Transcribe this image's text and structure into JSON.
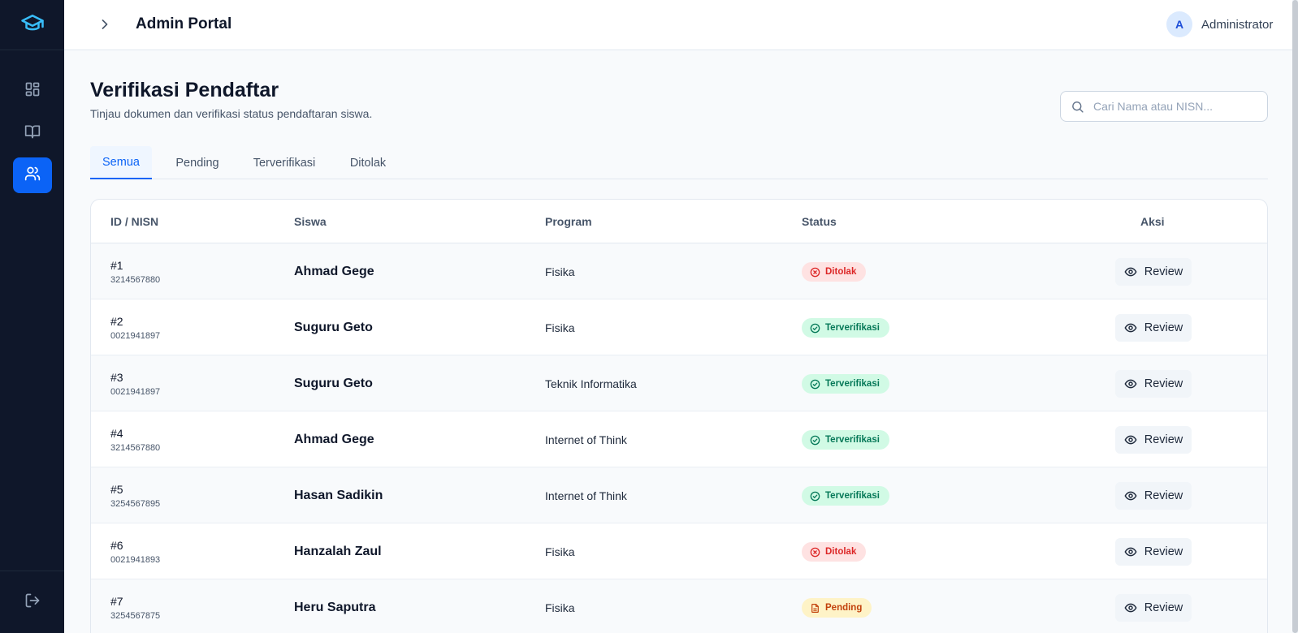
{
  "header": {
    "title": "Admin Portal",
    "avatar_initial": "A",
    "user_name": "Administrator"
  },
  "page": {
    "title": "Verifikasi Pendaftar",
    "subtitle": "Tinjau dokumen dan verifikasi status pendaftaran siswa.",
    "search_placeholder": "Cari Nama atau NISN...",
    "search_value": ""
  },
  "tabs": [
    {
      "label": "Semua",
      "active": true
    },
    {
      "label": "Pending",
      "active": false
    },
    {
      "label": "Terverifikasi",
      "active": false
    },
    {
      "label": "Ditolak",
      "active": false
    }
  ],
  "table": {
    "columns": [
      "ID / NISN",
      "Siswa",
      "Program",
      "Status",
      "Aksi"
    ],
    "rows": [
      {
        "id": "#1",
        "nisn": "3214567880",
        "name": "Ahmad Gege",
        "program": "Fisika",
        "status": "Ditolak",
        "action": "Review"
      },
      {
        "id": "#2",
        "nisn": "0021941897",
        "name": "Suguru Geto",
        "program": "Fisika",
        "status": "Terverifikasi",
        "action": "Review"
      },
      {
        "id": "#3",
        "nisn": "0021941897",
        "name": "Suguru Geto",
        "program": "Teknik Informatika",
        "status": "Terverifikasi",
        "action": "Review"
      },
      {
        "id": "#4",
        "nisn": "3214567880",
        "name": "Ahmad Gege",
        "program": "Internet of Think",
        "status": "Terverifikasi",
        "action": "Review"
      },
      {
        "id": "#5",
        "nisn": "3254567895",
        "name": "Hasan Sadikin",
        "program": "Internet of Think",
        "status": "Terverifikasi",
        "action": "Review"
      },
      {
        "id": "#6",
        "nisn": "0021941893",
        "name": "Hanzalah Zaul",
        "program": "Fisika",
        "status": "Ditolak",
        "action": "Review"
      },
      {
        "id": "#7",
        "nisn": "3254567875",
        "name": "Heru Saputra",
        "program": "Fisika",
        "status": "Pending",
        "action": "Review"
      }
    ]
  },
  "status_colors": {
    "Ditolak": {
      "bg": "#fee2e2",
      "fg": "#dc2626",
      "icon": "x-circle-icon"
    },
    "Terverifikasi": {
      "bg": "#d1fae5",
      "fg": "#047857",
      "icon": "check-circle-icon"
    },
    "Pending": {
      "bg": "#fef3c7",
      "fg": "#c2410c",
      "icon": "document-icon"
    }
  },
  "sidebar": {
    "items": [
      {
        "icon": "dashboard-icon",
        "active": false
      },
      {
        "icon": "book-icon",
        "active": false
      },
      {
        "icon": "users-icon",
        "active": true
      }
    ],
    "logo_icon": "graduation-cap-icon",
    "logout_icon": "logout-icon"
  },
  "colors": {
    "accent": "#0b63f6",
    "sidebar_bg": "#0f172a",
    "page_bg": "#f8fafc"
  }
}
